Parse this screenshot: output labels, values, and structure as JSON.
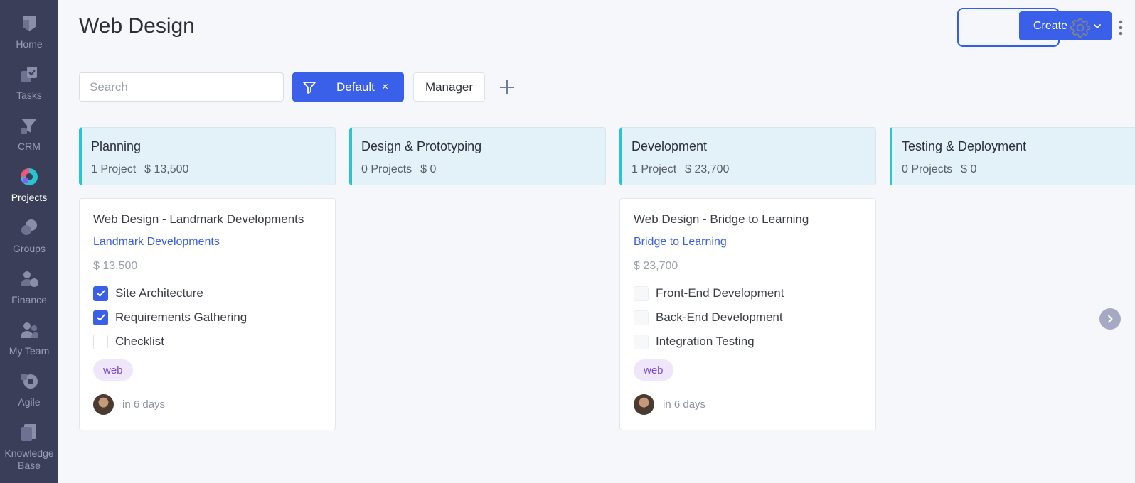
{
  "sidebar": {
    "items": [
      {
        "label": "Home",
        "icon": "home-icon"
      },
      {
        "label": "Tasks",
        "icon": "tasks-icon"
      },
      {
        "label": "CRM",
        "icon": "crm-icon"
      },
      {
        "label": "Projects",
        "icon": "projects-icon",
        "active": true
      },
      {
        "label": "Groups",
        "icon": "groups-icon"
      },
      {
        "label": "Finance",
        "icon": "finance-icon"
      },
      {
        "label": "My Team",
        "icon": "team-icon"
      },
      {
        "label": "Agile",
        "icon": "agile-icon"
      },
      {
        "label": "Knowledge",
        "label2": "Base",
        "icon": "knowledge-base-icon"
      }
    ]
  },
  "header": {
    "title": "Web Design",
    "create_label": "Create"
  },
  "toolbar": {
    "search_placeholder": "Search",
    "filter_label": "Default",
    "filter_close": "×",
    "manager_label": "Manager"
  },
  "columns": [
    {
      "title": "Planning",
      "count": "1 Project",
      "amount": "$ 13,500"
    },
    {
      "title": "Design & Prototyping",
      "count": "0 Projects",
      "amount": "$ 0"
    },
    {
      "title": "Development",
      "count": "1 Project",
      "amount": "$ 23,700"
    },
    {
      "title": "Testing & Deployment",
      "count": "0 Projects",
      "amount": "$ 0"
    }
  ],
  "cards": [
    {
      "title": "Web Design - Landmark Developments",
      "client": "Landmark Developments",
      "amount": "$ 13,500",
      "tasks": [
        {
          "label": "Site Architecture",
          "done": true
        },
        {
          "label": "Requirements Gathering",
          "done": true
        },
        {
          "label": "Checklist",
          "done": false
        }
      ],
      "tag": "web",
      "due": "in 6 days"
    },
    {
      "title": "Web Design - Bridge to Learning",
      "client": "Bridge to Learning",
      "amount": "$ 23,700",
      "tasks": [
        {
          "label": "Front-End Development",
          "done": false
        },
        {
          "label": "Back-End Development",
          "done": false
        },
        {
          "label": "Integration Testing",
          "done": false
        }
      ],
      "tag": "web",
      "due": "in 6 days"
    }
  ],
  "colors": {
    "sidebar_bg": "#3b3e58",
    "accent": "#3a5fe8",
    "column_stripe": "#2ac3d3",
    "tag_bg": "#efe6fb",
    "tag_text": "#7a4fc7"
  }
}
